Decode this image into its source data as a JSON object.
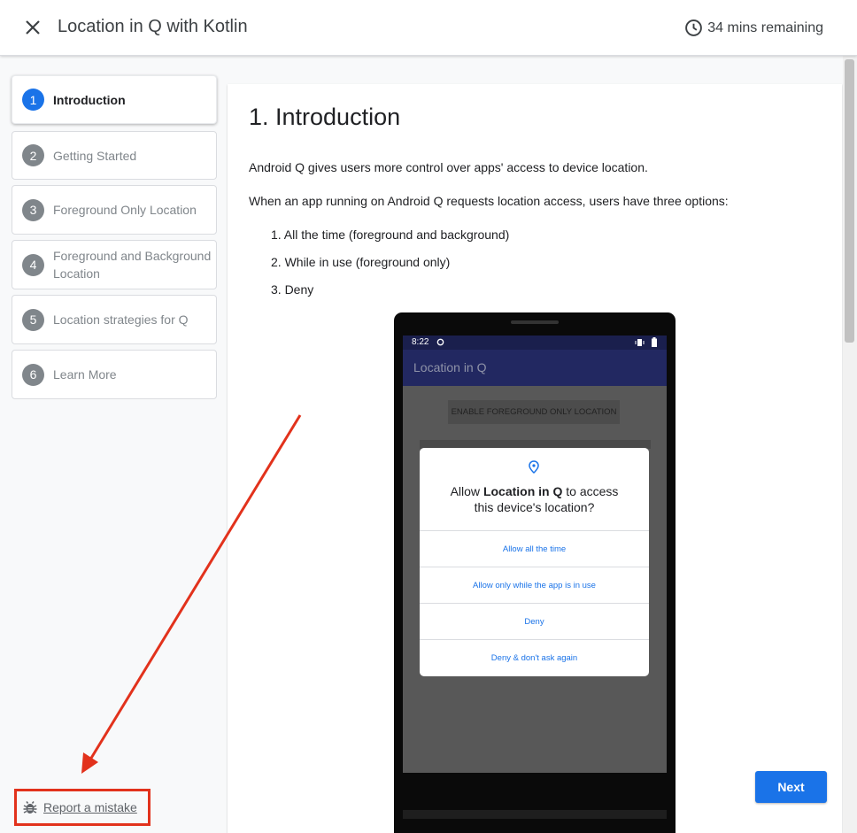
{
  "header": {
    "title": "Location in Q with Kotlin",
    "remaining": "34 mins remaining"
  },
  "sidebar": {
    "steps": [
      {
        "num": "1",
        "label": "Introduction",
        "active": true
      },
      {
        "num": "2",
        "label": "Getting Started"
      },
      {
        "num": "3",
        "label": "Foreground Only Location"
      },
      {
        "num": "4",
        "label": "Foreground and Background Location"
      },
      {
        "num": "5",
        "label": "Location strategies for Q"
      },
      {
        "num": "6",
        "label": "Learn More"
      }
    ],
    "report_label": "Report a mistake"
  },
  "content": {
    "heading": "1. Introduction",
    "para1": "Android Q gives users more control over apps' access to device location.",
    "para2": "When an app running on Android Q requests location access, users have three options:",
    "list": [
      "1. All the time (foreground and background)",
      "2. While in use (foreground only)",
      "3. Deny"
    ],
    "phone": {
      "time": "8:22",
      "app_title": "Location in Q",
      "enable_button": "ENABLE FOREGROUND ONLY LOCATION",
      "dialog": {
        "title_pre": "Allow ",
        "title_app": "Location in Q",
        "title_mid": " to access",
        "title_line2": "this device's location?",
        "options": [
          "Allow all the time",
          "Allow only while the app is in use",
          "Deny",
          "Deny & don't ask again"
        ]
      }
    }
  },
  "next_label": "Next"
}
